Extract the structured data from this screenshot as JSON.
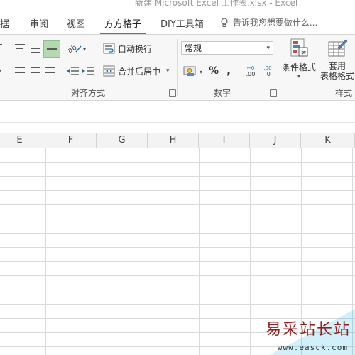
{
  "window": {
    "title": "新建 Microsoft Excel 工作表.xlsx - Excel"
  },
  "tabs": [
    {
      "label": "据"
    },
    {
      "label": "审阅"
    },
    {
      "label": "视图"
    },
    {
      "label": "方方格子",
      "active": true
    },
    {
      "label": "DIY工具箱"
    }
  ],
  "tell_me": {
    "placeholder": "告诉我您想要做什么..."
  },
  "ribbon": {
    "alignment": {
      "group_label": "对齐方式",
      "wrap_text_label": "自动换行",
      "merge_center_label": "合并后居中"
    },
    "number": {
      "group_label": "数字",
      "format_value": "常规",
      "percent_symbol": "%",
      "comma_symbol": ",",
      "inc_decimal_label": ".00",
      "dec_decimal_label": ".0"
    },
    "styles": {
      "group_label": "样式",
      "conditional_format_label": "条件格式",
      "table_format_label_line1": "套用",
      "table_format_label_line2": "表格格式"
    }
  },
  "columns": [
    "E",
    "F",
    "G",
    "H",
    "I",
    "J",
    "K"
  ],
  "watermark": {
    "text": "易采站长站",
    "url": "www.easck.com"
  },
  "colors": {
    "active_tab_underline": "#c0504d",
    "selected_button": "#b5d7b1",
    "watermark_text": "#8f1f1f"
  }
}
